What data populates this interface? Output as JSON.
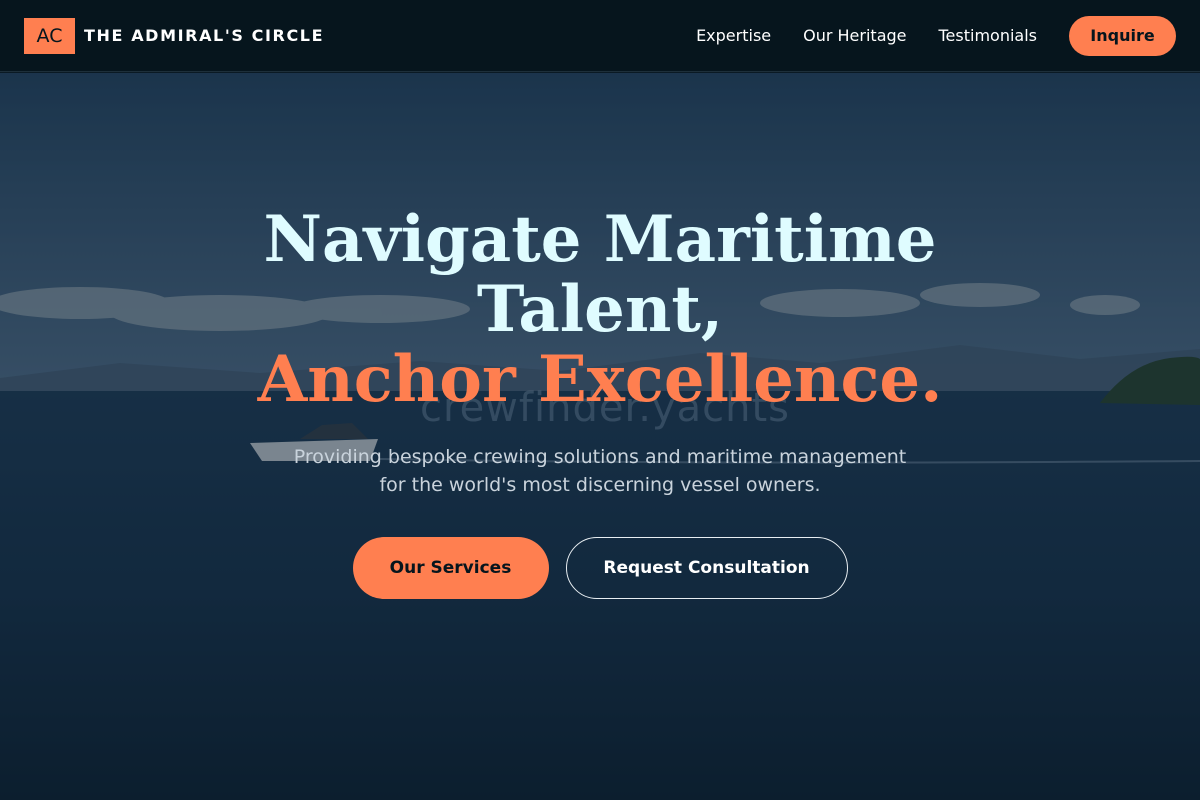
{
  "header": {
    "logo_text": "AC",
    "brand_name": "THE ADMIRAL'S CIRCLE",
    "nav": [
      {
        "label": "Expertise"
      },
      {
        "label": "Our Heritage"
      },
      {
        "label": "Testimonials"
      }
    ],
    "cta_label": "Inquire"
  },
  "hero": {
    "headline_line1": "Navigate Maritime",
    "headline_line2": "Talent,",
    "headline_accent": "Anchor Excellence.",
    "subtitle_line1": "Providing bespoke crewing solutions and maritime management",
    "subtitle_line2": "for the world's most discerning vessel owners.",
    "watermark": "crewfinder.yachts",
    "primary_button": "Our Services",
    "secondary_button": "Request Consultation"
  },
  "colors": {
    "accent": "#ff7f50",
    "header_bg": "#06151d",
    "headline": "#dffcff"
  }
}
